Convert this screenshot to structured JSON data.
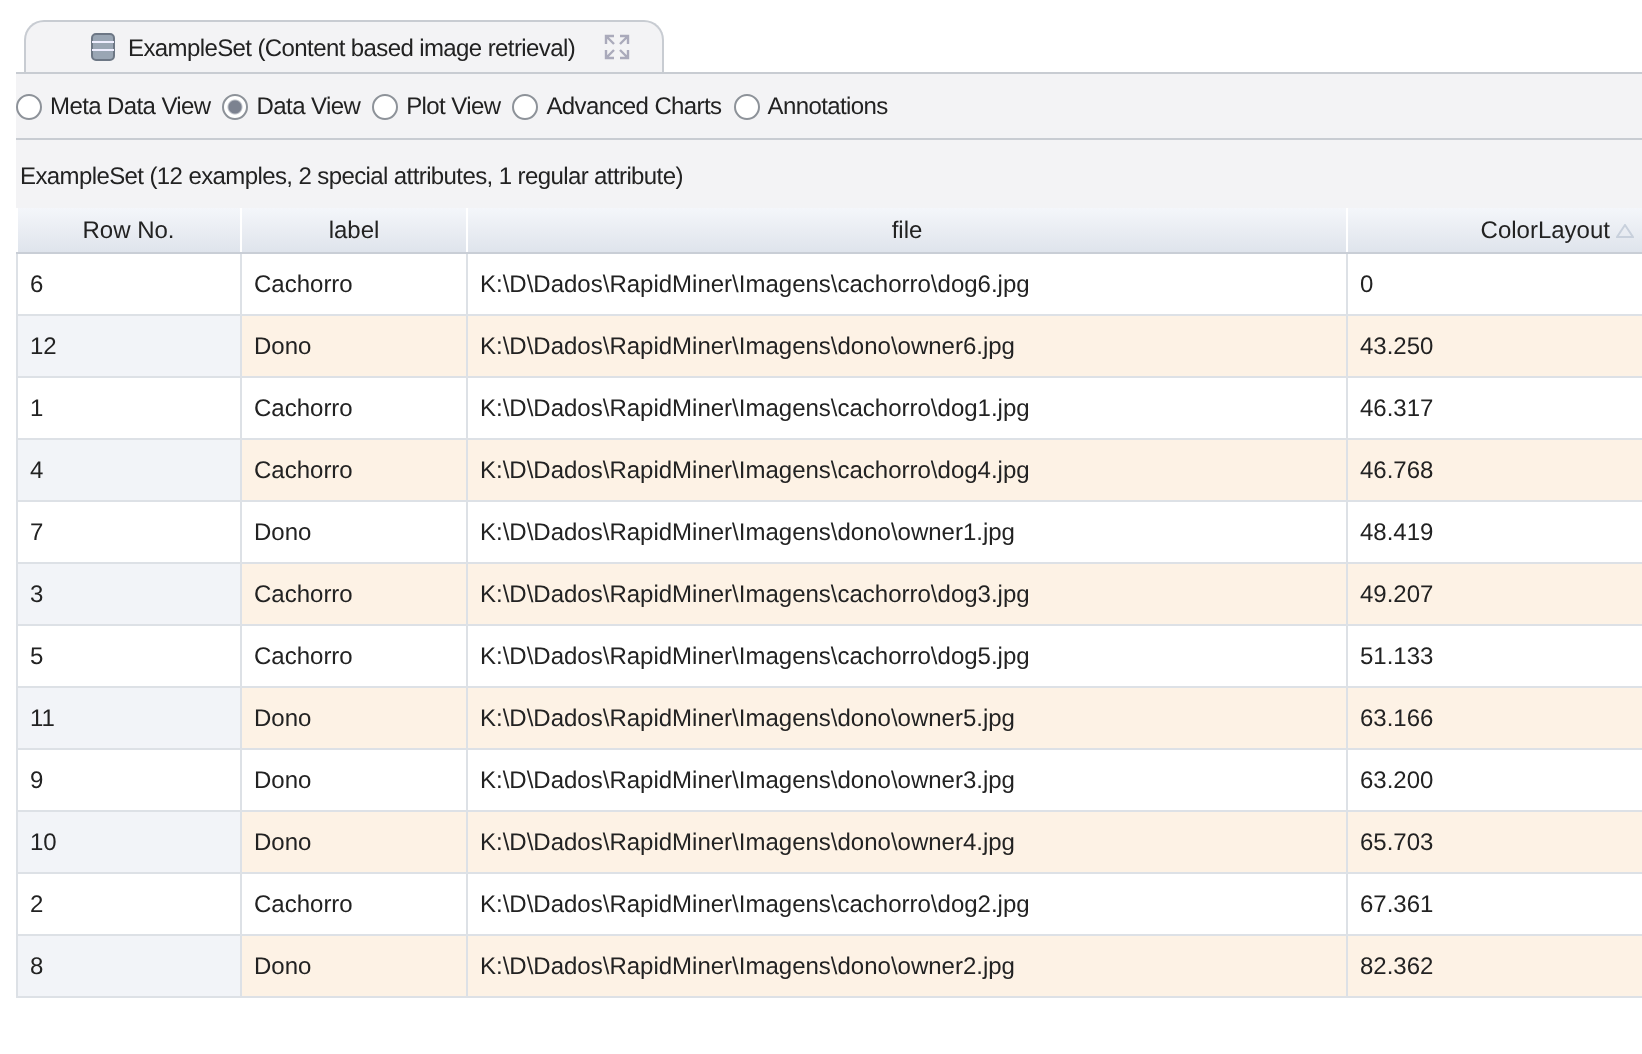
{
  "tab": {
    "title": "ExampleSet (Content based image retrieval)"
  },
  "views": [
    {
      "label": "Meta Data View",
      "selected": false
    },
    {
      "label": "Data View",
      "selected": true
    },
    {
      "label": "Plot View",
      "selected": false
    },
    {
      "label": "Advanced Charts",
      "selected": false
    },
    {
      "label": "Annotations",
      "selected": false
    }
  ],
  "summary": "ExampleSet (12 examples, 2 special attributes, 1 regular attribute)",
  "table": {
    "columns": [
      {
        "label": "Row No.",
        "sorted": false
      },
      {
        "label": "label",
        "sorted": false
      },
      {
        "label": "file",
        "sorted": false
      },
      {
        "label": "ColorLayout",
        "sorted": true
      }
    ],
    "rows": [
      [
        "6",
        "Cachorro",
        "K:\\D\\Dados\\RapidMiner\\Imagens\\cachorro\\dog6.jpg",
        "0"
      ],
      [
        "12",
        "Dono",
        "K:\\D\\Dados\\RapidMiner\\Imagens\\dono\\owner6.jpg",
        "43.250"
      ],
      [
        "1",
        "Cachorro",
        "K:\\D\\Dados\\RapidMiner\\Imagens\\cachorro\\dog1.jpg",
        "46.317"
      ],
      [
        "4",
        "Cachorro",
        "K:\\D\\Dados\\RapidMiner\\Imagens\\cachorro\\dog4.jpg",
        "46.768"
      ],
      [
        "7",
        "Dono",
        "K:\\D\\Dados\\RapidMiner\\Imagens\\dono\\owner1.jpg",
        "48.419"
      ],
      [
        "3",
        "Cachorro",
        "K:\\D\\Dados\\RapidMiner\\Imagens\\cachorro\\dog3.jpg",
        "49.207"
      ],
      [
        "5",
        "Cachorro",
        "K:\\D\\Dados\\RapidMiner\\Imagens\\cachorro\\dog5.jpg",
        "51.133"
      ],
      [
        "11",
        "Dono",
        "K:\\D\\Dados\\RapidMiner\\Imagens\\dono\\owner5.jpg",
        "63.166"
      ],
      [
        "9",
        "Dono",
        "K:\\D\\Dados\\RapidMiner\\Imagens\\dono\\owner3.jpg",
        "63.200"
      ],
      [
        "10",
        "Dono",
        "K:\\D\\Dados\\RapidMiner\\Imagens\\dono\\owner4.jpg",
        "65.703"
      ],
      [
        "2",
        "Cachorro",
        "K:\\D\\Dados\\RapidMiner\\Imagens\\cachorro\\dog2.jpg",
        "67.361"
      ],
      [
        "8",
        "Dono",
        "K:\\D\\Dados\\RapidMiner\\Imagens\\dono\\owner2.jpg",
        "82.362"
      ]
    ]
  }
}
